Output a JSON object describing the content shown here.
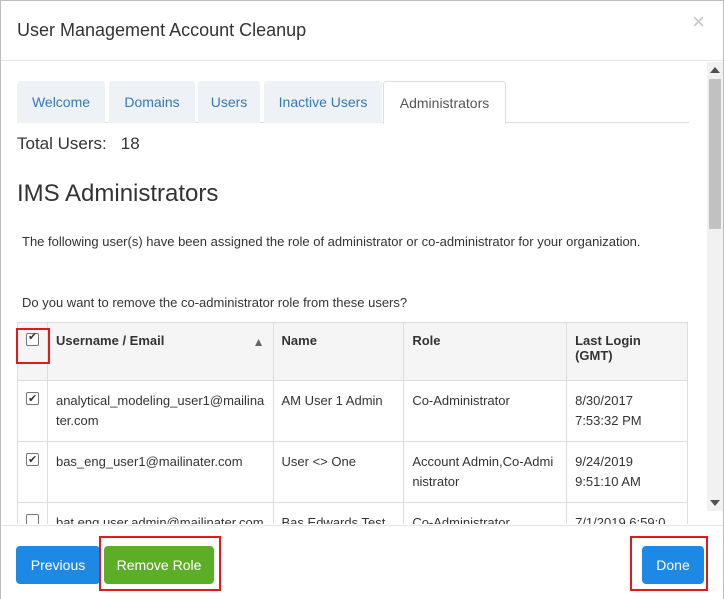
{
  "modal": {
    "title": "User Management Account Cleanup",
    "close": "×"
  },
  "tabs": [
    {
      "label": "Welcome",
      "active": false
    },
    {
      "label": "Domains",
      "active": false
    },
    {
      "label": "Users",
      "active": false
    },
    {
      "label": "Inactive Users",
      "active": false
    },
    {
      "label": "Administrators",
      "active": true
    }
  ],
  "summary": {
    "total_label": "Total Users:",
    "total_value": "18"
  },
  "section": {
    "title": "IMS Administrators",
    "description": "The following user(s) have been assigned the role of administrator or co-administrator for your organization.",
    "question": "Do you want to remove the co-administrator role from these users?"
  },
  "table": {
    "headers": {
      "username": "Username / Email",
      "name": "Name",
      "role": "Role",
      "last_login": "Last Login (GMT)"
    },
    "select_all_checked": true,
    "rows": [
      {
        "checked": true,
        "username": "analytical_modeling_user1@mailinater.com",
        "name": "AM User 1 Admin",
        "role": "Co-Administrator",
        "last_login": "8/30/2017 7:53:32 PM"
      },
      {
        "checked": true,
        "username": "bas_eng_user1@mailinater.com",
        "name": "User <> One",
        "role": "Account Admin,Co-Administrator",
        "last_login": "9/24/2019 9:51:10 AM"
      },
      {
        "checked": false,
        "username": "bat.eng.user.admin@mailinater.com",
        "name": "Bas Edwards Test",
        "role": "Co-Administrator",
        "last_login": "7/1/2019 6:59:0"
      }
    ]
  },
  "footer": {
    "previous": "Previous",
    "remove_role": "Remove Role",
    "done": "Done"
  },
  "colors": {
    "primary_blue": "#1e88e5",
    "success_green": "#5cae27",
    "highlight_red": "#e0191e",
    "tab_link": "#337ab7"
  }
}
